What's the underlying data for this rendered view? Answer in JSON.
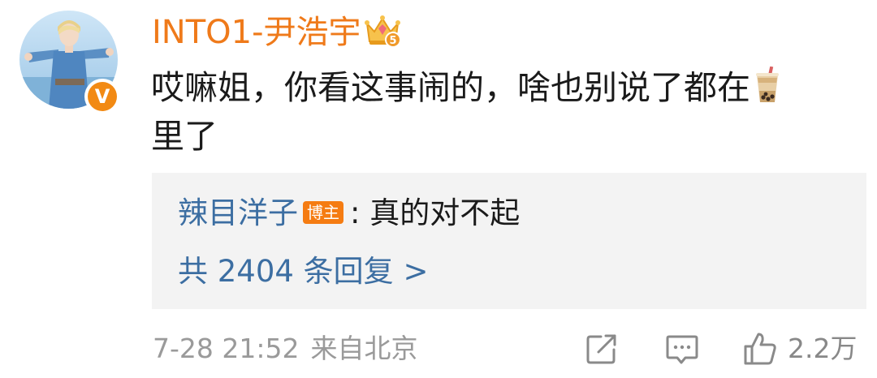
{
  "user": {
    "name": "INTO1-尹浩宇",
    "verified_badge": "V",
    "avatar": "avatar-photo",
    "crown_icon": "vip-crown-icon",
    "crown_level": "5"
  },
  "comment": {
    "line1": "哎嘛姐，你看这事闹的，啥也别说了都在",
    "line1_emoji": "milk-tea-icon",
    "line2": "里了"
  },
  "reply_preview": {
    "author": "辣目洋子",
    "author_tag": "博主",
    "colon": ":",
    "text": "真的对不起",
    "more": "共 2404 条回复 >"
  },
  "footer": {
    "date": "7-28 21:52",
    "source": "来自北京",
    "like_count": "2.2万"
  },
  "colors": {
    "username": "#ef7a1a",
    "link": "#3c6ea2",
    "meta": "#9a9a9a",
    "reply_bg": "#f3f3f3"
  }
}
